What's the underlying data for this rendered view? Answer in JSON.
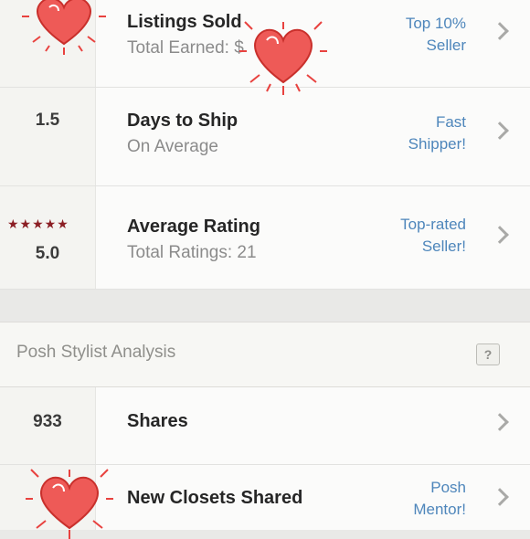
{
  "stats": [
    {
      "value": "",
      "title": "Listings Sold",
      "subtitle": "Total Earned: $",
      "badge_line1": "Top 10%",
      "badge_line2": "Seller"
    },
    {
      "value": "1.5",
      "title": "Days to Ship",
      "subtitle": "On Average",
      "badge_line1": "Fast",
      "badge_line2": "Shipper!"
    },
    {
      "value": "5.0",
      "stars": "★★★★★",
      "title": "Average Rating",
      "subtitle": "Total Ratings: 21",
      "badge_line1": "Top-rated",
      "badge_line2": "Seller!"
    }
  ],
  "section": {
    "title": "Posh Stylist Analysis",
    "help": "?"
  },
  "analysis": [
    {
      "value": "933",
      "title": "Shares"
    },
    {
      "value": "",
      "title": "New Closets Shared",
      "badge_line1": "Posh",
      "badge_line2": "Mentor!"
    }
  ],
  "colors": {
    "accent": "#4e86bb",
    "star": "#8b1e24",
    "heart": "#e8423f"
  },
  "icons": [
    "chevron-right-icon",
    "help-icon",
    "heart-doodle-icon",
    "star-icon"
  ]
}
